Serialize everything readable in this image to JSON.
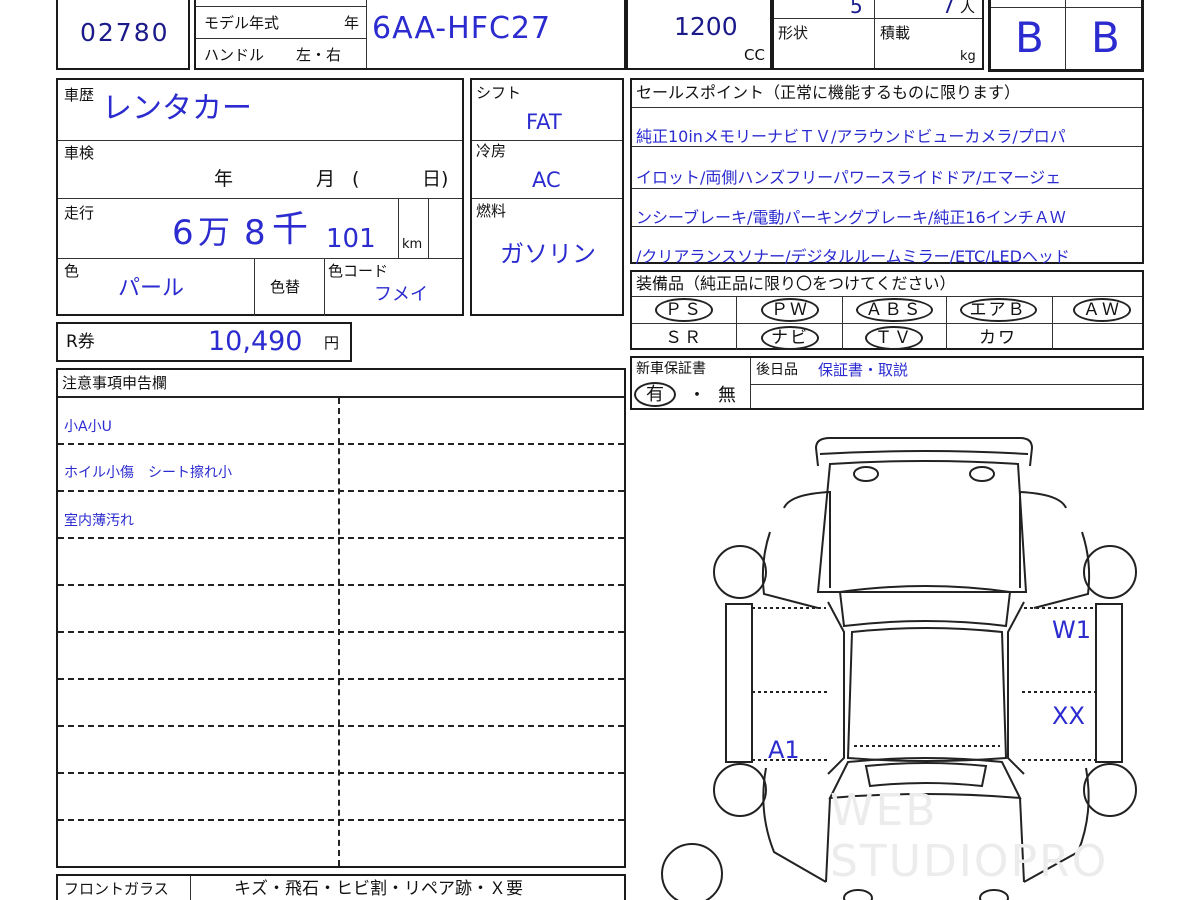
{
  "header": {
    "lot_number": "02780",
    "model_year_label": "モデル年式",
    "year_unit": "年",
    "handle_label": "ハンドル",
    "handle_options": "左・右",
    "model_code": "6AA-HFC27",
    "displacement": "1200",
    "displacement_unit": "CC",
    "seats_value": "5",
    "capacity_value": "7",
    "capacity_unit": "人",
    "shape_label": "形状",
    "load_label": "積載",
    "load_unit": "kg",
    "grade_exterior": "B",
    "grade_interior": "B"
  },
  "history": {
    "label": "車歴",
    "value": "レンタカー"
  },
  "inspection": {
    "label": "車検",
    "year_unit": "年",
    "month_unit": "月",
    "paren_open": "(",
    "day_unit": "日)"
  },
  "mileage": {
    "label": "走行",
    "man_digit": "6",
    "man_unit": "万",
    "sen_digit": "8",
    "sen_unit": "千",
    "rest": "101",
    "unit": "km"
  },
  "color": {
    "label": "色",
    "value": "パール",
    "change_label": "色替",
    "code_label": "色コード",
    "code_value": "フメイ"
  },
  "shift": {
    "label": "シフト",
    "value": "FAT"
  },
  "ac": {
    "label": "冷房",
    "value": "AC"
  },
  "fuel": {
    "label": "燃料",
    "value": "ガソリン"
  },
  "recycle": {
    "label": "R券",
    "value": "10,490",
    "unit": "円"
  },
  "sales_points": {
    "title": "セールスポイント（正常に機能するものに限ります）",
    "lines": [
      "純正10inメモリーナビＴＶ/アラウンドビューカメラ/プロパ",
      "イロット/両側ハンズフリーパワースライドドア/エマージェ",
      "ンシーブレーキ/電動パーキングブレーキ/純正16インチＡＷ",
      "/クリアランスソナー/デジタルルームミラー/ETC/LEDヘッド"
    ]
  },
  "equipment": {
    "title": "装備品（純正品に限り〇をつけてください）",
    "items": [
      {
        "label": "ＰＳ",
        "checked": true
      },
      {
        "label": "ＰＷ",
        "checked": true
      },
      {
        "label": "ＡＢＳ",
        "checked": true
      },
      {
        "label": "エアＢ",
        "checked": true
      },
      {
        "label": "ＡＷ",
        "checked": true
      },
      {
        "label": "ＳＲ",
        "checked": false
      },
      {
        "label": "ナビ",
        "checked": true
      },
      {
        "label": "ＴＶ",
        "checked": true
      },
      {
        "label": "カワ",
        "checked": false
      },
      {
        "label": "",
        "checked": false
      }
    ]
  },
  "warranty": {
    "label": "新車保証書",
    "yes": "有",
    "sep": "・",
    "no": "無",
    "aftermarket_label": "後日品",
    "aftermarket_value": "保証書・取説"
  },
  "notes": {
    "title": "注意事項申告欄",
    "rows": [
      "小A小U",
      "ホイル小傷　シート擦れ小",
      "室内薄汚れ",
      "",
      "",
      "",
      "",
      "",
      "",
      ""
    ]
  },
  "windshield": {
    "label": "フロントガラス",
    "options": "キズ・飛石・ヒビ割・リペア跡・Ｘ要"
  },
  "diagram_marks": {
    "w1": "W1",
    "xx": "XX",
    "a1": "A1"
  },
  "watermark": "WEB STUDIOPRO"
}
